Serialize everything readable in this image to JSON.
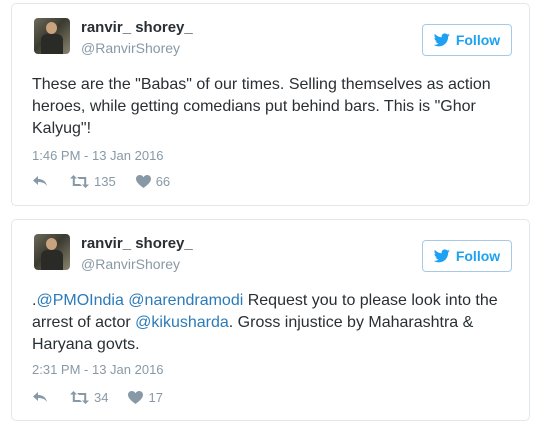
{
  "tweets": [
    {
      "name": "ranvir_ shorey_",
      "handle": "@RanvirShorey",
      "follow_label": "Follow",
      "text": "These are the \"Babas\" of our times. Selling themselves as action heroes, while getting comedians put behind bars. This is \"Ghor Kalyug\"!",
      "timestamp": "1:46 PM - 13 Jan 2016",
      "retweets": "135",
      "likes": "66"
    },
    {
      "name": "ranvir_ shorey_",
      "handle": "@RanvirShorey",
      "follow_label": "Follow",
      "text_parts": {
        "p1": ".",
        "m1": "@PMOIndia",
        "p2": " ",
        "m2": "@narendramodi",
        "p3": " Request you to please look into the arrest of actor ",
        "m3": "@kikusharda",
        "p4": ". Gross injustice by Maharashtra & Haryana govts."
      },
      "timestamp": "2:31 PM - 13 Jan 2016",
      "retweets": "34",
      "likes": "17"
    }
  ],
  "icons": {
    "follow": "twitter-bird-icon",
    "reply": "reply-icon",
    "retweet": "retweet-icon",
    "like": "heart-icon"
  },
  "colors": {
    "accent": "#1da1f2",
    "link": "#2b7bb9",
    "muted": "#8899a6",
    "text": "#292f33",
    "border": "#e1e8ed"
  }
}
